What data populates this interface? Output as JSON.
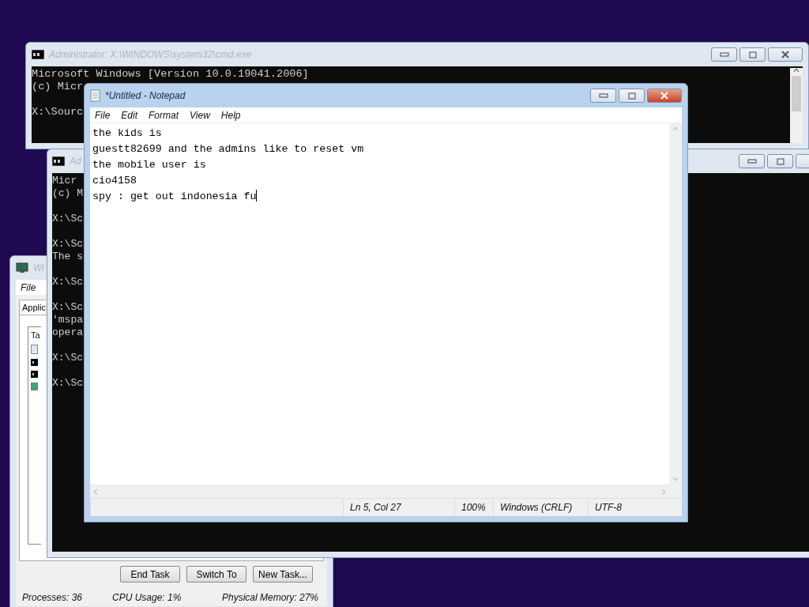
{
  "windows": [
    {
      "kind": "console",
      "title": "Administrator: X:\\WINDOWS\\system32\\cmd.exe",
      "active": false,
      "blocks": [
        [
          "Microsoft Windows [Version 10.0.19041.2006]",
          "(c) Micr"
        ],
        [
          "X:\\Sourc"
        ]
      ]
    },
    {
      "kind": "taskmanager",
      "title": "Wi",
      "active": false,
      "menu": [
        "File"
      ],
      "tabs": [
        {
          "label": "Applic",
          "selected": true
        }
      ],
      "list_header": "Ta",
      "buttons": [
        "End Task",
        "Switch To",
        "New Task..."
      ],
      "status_bar": [
        "Processes: 36",
        "CPU Usage: 1%",
        "Physical Memory: 27%"
      ]
    },
    {
      "kind": "console",
      "title": "Ad",
      "active": false,
      "blocks": [
        [
          "Micr",
          "(c) M"
        ],
        [
          "X:\\Sc"
        ],
        [
          "X:\\Sc",
          "The s"
        ],
        [
          "X:\\Sc"
        ],
        [
          "X:\\Sc",
          "'mspa",
          "opera"
        ],
        [
          "X:\\Sc"
        ],
        [
          "X:\\Sc"
        ]
      ]
    },
    {
      "kind": "notepad",
      "title": "*Untitled - Notepad",
      "active": true,
      "menu": [
        "File",
        "Edit",
        "Format",
        "View",
        "Help"
      ],
      "text": [
        "the kids is",
        "guestt82699 and the admins like to reset vm",
        "the mobile user is",
        "cio4158",
        "spy : get out indonesia fu"
      ],
      "status_bar": [
        "Ln 5, Col 27",
        "100%",
        "Windows (CRLF)",
        "UTF-8"
      ]
    }
  ]
}
